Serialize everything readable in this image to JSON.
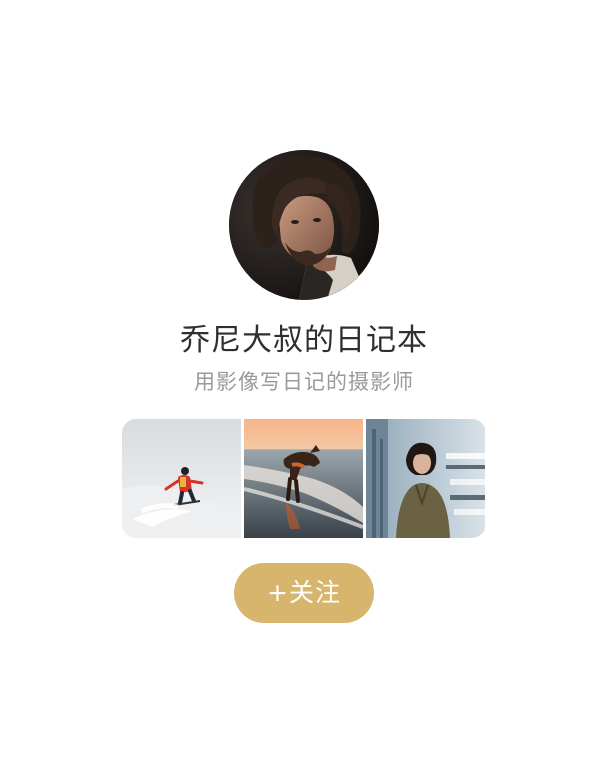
{
  "profile": {
    "name": "乔尼大叔的日记本",
    "tagline": "用影像写日记的摄影师",
    "avatar_icon": "portrait-photo"
  },
  "photos": [
    {
      "icon": "snowboarder-photo"
    },
    {
      "icon": "dog-on-beach-photo"
    },
    {
      "icon": "woman-portrait-photo"
    }
  ],
  "actions": {
    "follow_label": "+关注"
  },
  "colors": {
    "follow_button": "#d7b56d",
    "name_text": "#2f2f2f",
    "tagline_text": "#9a9a9a"
  }
}
